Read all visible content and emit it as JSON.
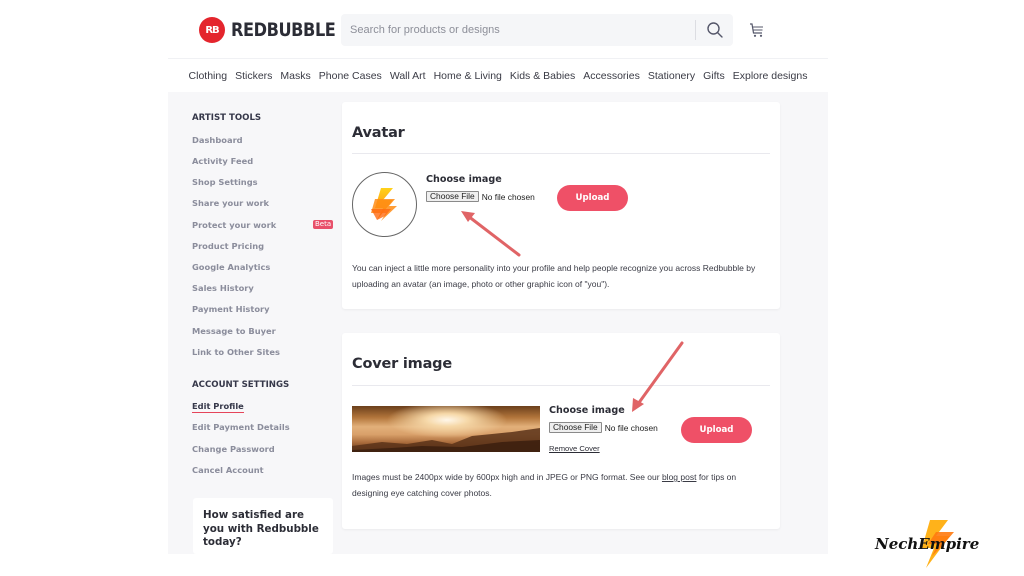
{
  "header": {
    "brand": "REDBUBBLE",
    "logo_mark": "RB",
    "search_placeholder": "Search for products or designs",
    "search_icon": "search-icon",
    "cart_icon": "cart-icon"
  },
  "nav": {
    "items": [
      "Clothing",
      "Stickers",
      "Masks",
      "Phone Cases",
      "Wall Art",
      "Home & Living",
      "Kids & Babies",
      "Accessories",
      "Stationery",
      "Gifts",
      "Explore designs"
    ]
  },
  "sidebar": {
    "artist_tools_title": "ARTIST TOOLS",
    "artist_tools": [
      {
        "label": "Dashboard"
      },
      {
        "label": "Activity Feed"
      },
      {
        "label": "Shop Settings"
      },
      {
        "label": "Share your work"
      },
      {
        "label": "Protect your work",
        "badge": "Beta"
      },
      {
        "label": "Product Pricing"
      },
      {
        "label": "Google Analytics"
      },
      {
        "label": "Sales History"
      },
      {
        "label": "Payment History"
      },
      {
        "label": "Message to Buyer"
      },
      {
        "label": "Link to Other Sites"
      }
    ],
    "account_settings_title": "ACCOUNT SETTINGS",
    "account_settings": [
      {
        "label": "Edit Profile",
        "active": true
      },
      {
        "label": "Edit Payment Details"
      },
      {
        "label": "Change Password"
      },
      {
        "label": "Cancel Account"
      }
    ],
    "survey_text": "How satisfied are you with Redbubble today?"
  },
  "avatar_section": {
    "title": "Avatar",
    "choose_label": "Choose image",
    "file_button": "Choose File",
    "file_status": "No file chosen",
    "upload_label": "Upload",
    "description": "You can inject a little more personality into your profile and help people recognize you across Redbubble by uploading an avatar (an image, photo or other graphic icon of \"you\")."
  },
  "cover_section": {
    "title": "Cover image",
    "choose_label": "Choose image",
    "file_button": "Choose File",
    "file_status": "No file chosen",
    "remove_label": "Remove Cover",
    "upload_label": "Upload",
    "description_pre": "Images must be 2400px wide by 600px high and in JPEG or PNG format. See our ",
    "description_link": "blog post",
    "description_post": " for tips on designing eye catching cover photos."
  },
  "watermark": {
    "text": "NechEmpire"
  },
  "colors": {
    "brand_red": "#e4252d",
    "upload_pink": "#ef5067",
    "annotation_arrow": "#e06466",
    "active_underline": "#e5445a"
  }
}
